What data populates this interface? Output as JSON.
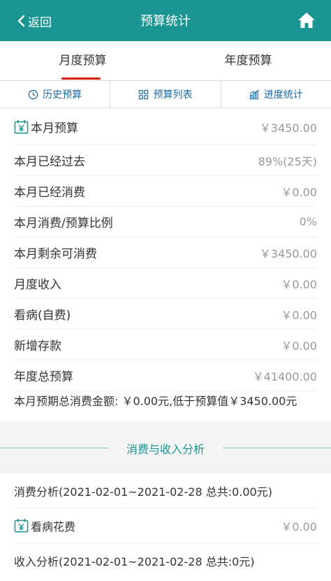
{
  "header": {
    "back_label": "返回",
    "title": "预算统计"
  },
  "tabs": [
    {
      "label": "月度预算"
    },
    {
      "label": "年度预算"
    }
  ],
  "toolbar": [
    {
      "label": "历史预算",
      "icon": "clock-icon"
    },
    {
      "label": "预算列表",
      "icon": "grid-icon"
    },
    {
      "label": "进度统计",
      "icon": "bar-chart-icon"
    }
  ],
  "rows": [
    {
      "label": "本月预算",
      "value": "￥3450.00",
      "icon": "calendar-yen-icon"
    },
    {
      "label": "本月已经过去",
      "value": "89%(25天)"
    },
    {
      "label": "本月已经消费",
      "value": "￥0.00"
    },
    {
      "label": "本月消费/预算比例",
      "value": "0%"
    },
    {
      "label": "本月剩余可消费",
      "value": "￥3450.00"
    },
    {
      "label": "月度收入",
      "value": "￥0.00"
    },
    {
      "label": "看病(自费)",
      "value": "￥0.00"
    },
    {
      "label": "新增存款",
      "value": "￥0.00"
    },
    {
      "label": "年度总预算",
      "value": "￥41400.00"
    }
  ],
  "summary": "本月预期总消费金额: ￥0.00元,低于预算值￥3450.00元",
  "section_title": "消费与收入分析",
  "analysis": [
    {
      "label": "消费分析(2021-02-01~2021-02-28 总共:0.00元)"
    },
    {
      "label": "看病花费",
      "value": "￥0.00",
      "icon": "calendar-yen-icon"
    },
    {
      "label": "收入分析(2021-02-01~2021-02-28 总共:0元)"
    }
  ],
  "colors": {
    "header": "#1a9592",
    "accent_underline": "#d81e06",
    "toolbar_text": "#1a6aa5"
  }
}
